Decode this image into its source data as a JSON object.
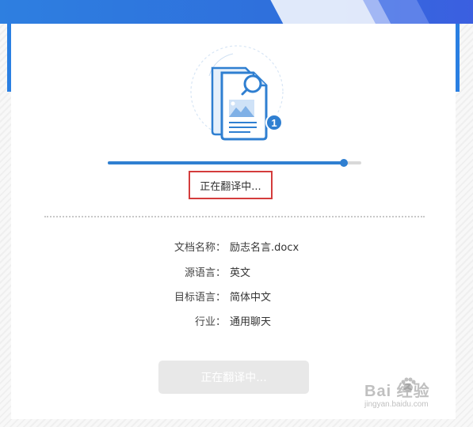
{
  "progress": {
    "fraction": 0.93
  },
  "status": {
    "text": "正在翻译中..."
  },
  "document_info": [
    {
      "label": "文档名称：",
      "value": "励志名言.docx"
    },
    {
      "label": "源语言：",
      "value": "英文"
    },
    {
      "label": "目标语言：",
      "value": "简体中文"
    },
    {
      "label": "行业：",
      "value": "通用聊天"
    }
  ],
  "action_button": {
    "label": "正在翻译中..."
  },
  "badge": {
    "count": "1"
  },
  "watermark": {
    "brand": "Bai  经验",
    "url": "jingyan.baidu.com"
  },
  "colors": {
    "accent": "#2f7fd1",
    "banner": "#2e7fe0",
    "highlight_border": "#d43c3c",
    "button_disabled": "#e8e8e8"
  },
  "icons": {
    "illustration": "document-search-icon",
    "watermark": "baidu-paw-icon"
  }
}
